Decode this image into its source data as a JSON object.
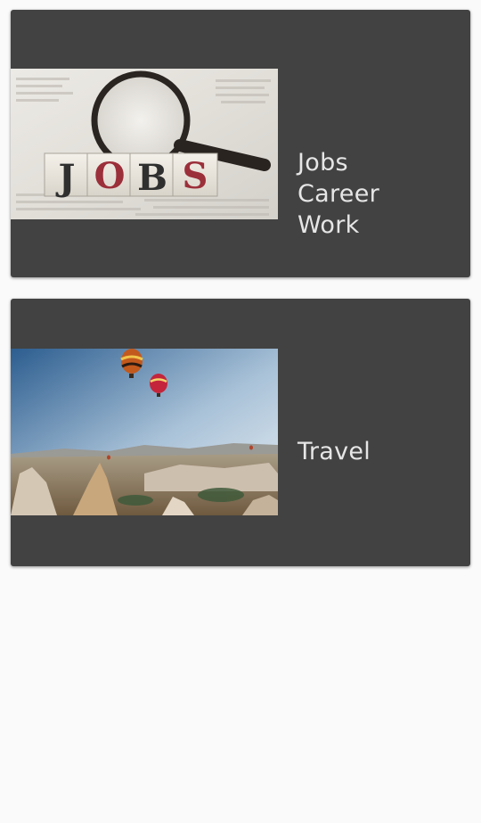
{
  "colors": {
    "background": "#fafafa",
    "card": "#424242",
    "card_text": "#e6e6e6"
  },
  "cards": [
    {
      "image": "jobs-photo",
      "image_text": "JOBS",
      "lines": [
        "Jobs",
        "Career",
        "Work"
      ]
    },
    {
      "image": "hot-air-balloons-photo",
      "lines": [
        "Travel"
      ]
    }
  ]
}
